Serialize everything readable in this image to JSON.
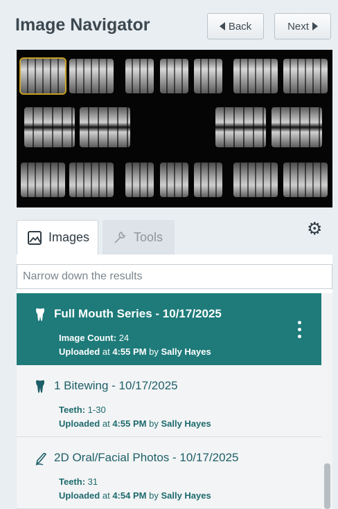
{
  "header": {
    "title": "Image Navigator",
    "back_label": "Back",
    "next_label": "Next"
  },
  "viewer": {
    "thumbnail_count": 18,
    "selected_index": 0
  },
  "tabs": [
    {
      "label": "Images",
      "active": true,
      "icon": "image-icon"
    },
    {
      "label": "Tools",
      "active": false,
      "icon": "tools-icon"
    }
  ],
  "settings_icon": "gear-icon",
  "search": {
    "placeholder": "Narrow down the results",
    "value": ""
  },
  "items": [
    {
      "title": "Full Mouth Series - 10/17/2025",
      "icon": "tooth-icon",
      "meta_label": "Image Count:",
      "meta_value": "24",
      "uploaded_word": "Uploaded",
      "at_word": "at",
      "time": "4:55 PM",
      "by_word": "by",
      "user": "Sally Hayes",
      "active": true
    },
    {
      "title": "1 Bitewing - 10/17/2025",
      "icon": "tooth-icon",
      "meta_label": "Teeth:",
      "meta_value": "1-30",
      "uploaded_word": "Uploaded",
      "at_word": "at",
      "time": "4:55 PM",
      "by_word": "by",
      "user": "Sally Hayes",
      "active": false
    },
    {
      "title": "2D Oral/Facial Photos - 10/17/2025",
      "icon": "pen-icon",
      "meta_label": "Teeth:",
      "meta_value": "31",
      "uploaded_word": "Uploaded",
      "at_word": "at",
      "time": "4:54 PM",
      "by_word": "by",
      "user": "Sally Hayes",
      "active": false
    }
  ],
  "colors": {
    "accent": "#1e7b7a",
    "background": "#e9eef2",
    "selection_outline": "#c9a227"
  }
}
